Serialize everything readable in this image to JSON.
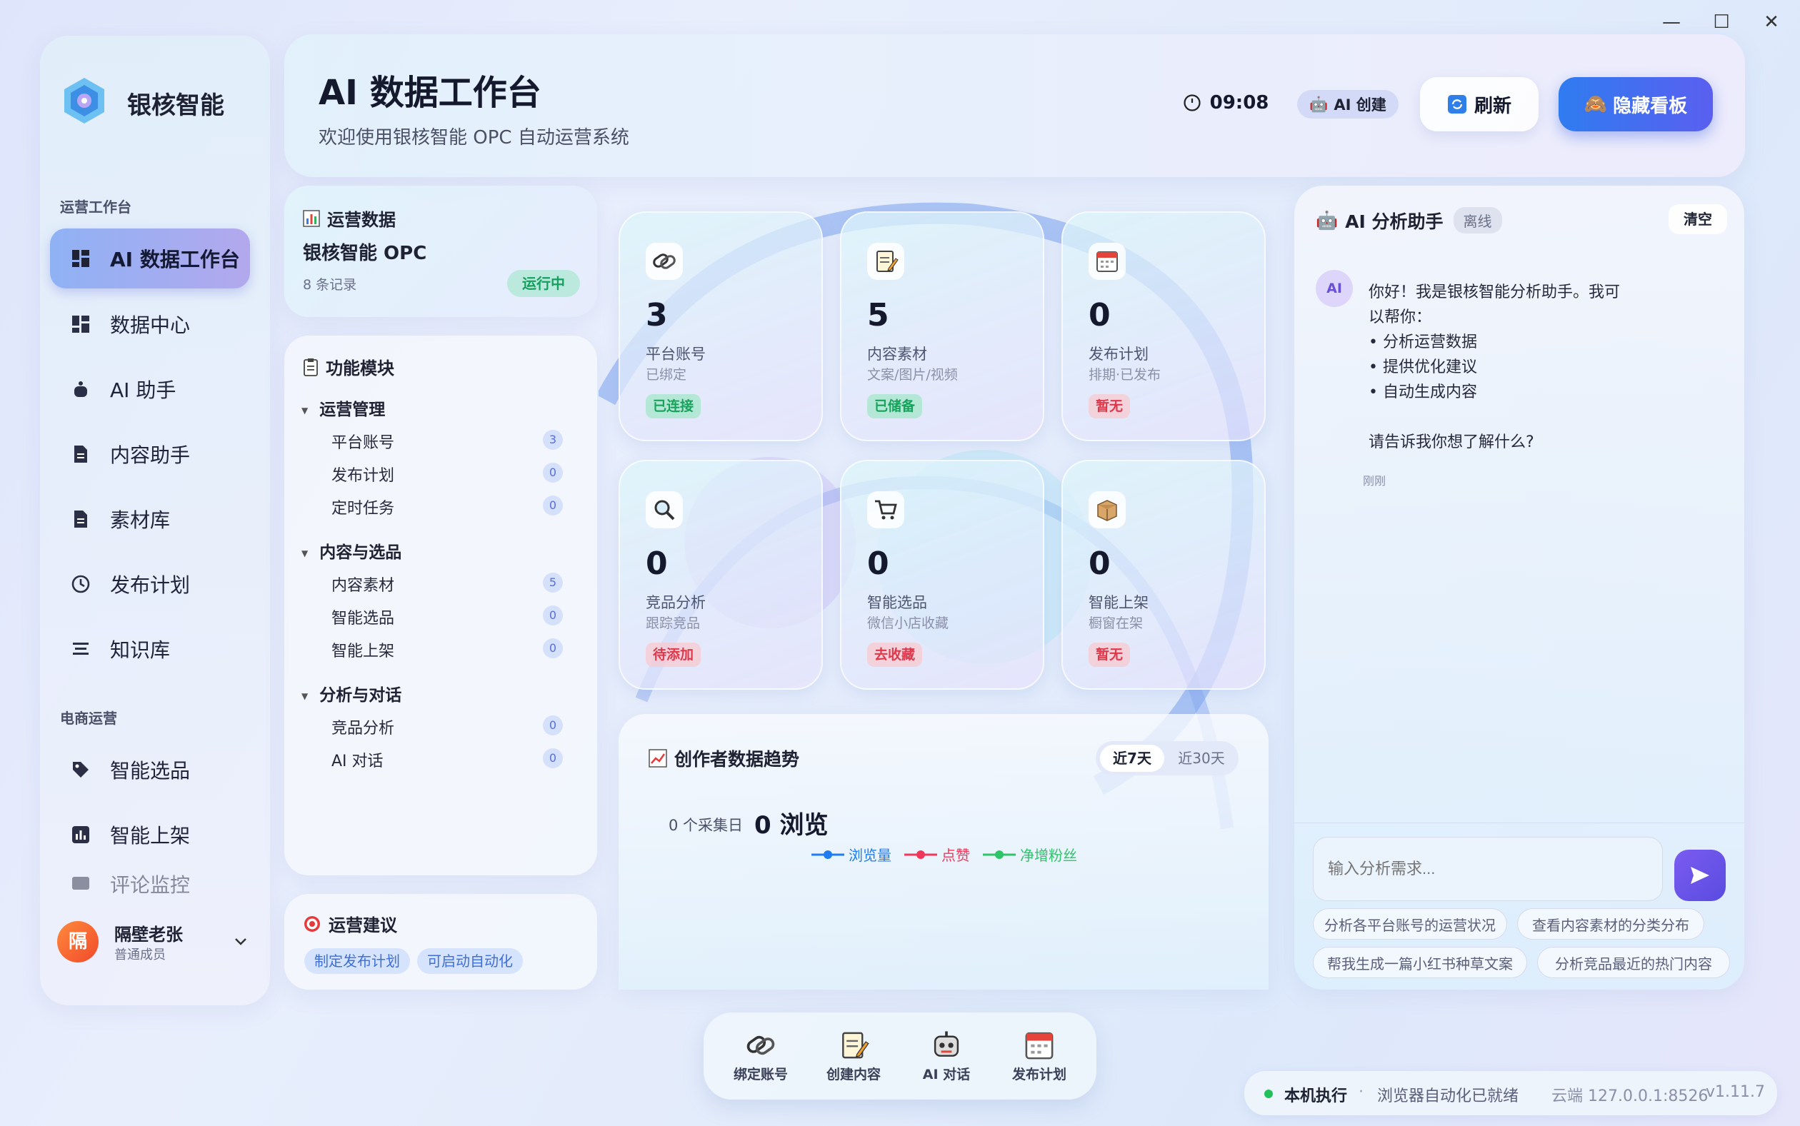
{
  "window": {
    "minimize": "—",
    "maximize": "☐",
    "close": "✕"
  },
  "brand": {
    "name": "银核智能"
  },
  "sidebar": {
    "section1": "运营工作台",
    "items": [
      {
        "label": "AI 数据工作台",
        "icon": "dashboard-icon"
      },
      {
        "label": "数据中心",
        "icon": "grid-icon"
      },
      {
        "label": "AI 助手",
        "icon": "robot-icon"
      },
      {
        "label": "内容助手",
        "icon": "document-icon"
      },
      {
        "label": "素材库",
        "icon": "file-icon"
      },
      {
        "label": "发布计划",
        "icon": "clock-icon"
      },
      {
        "label": "知识库",
        "icon": "book-icon"
      }
    ],
    "section2": "电商运营",
    "items2": [
      {
        "label": "智能选品",
        "icon": "tag-icon"
      },
      {
        "label": "智能上架",
        "icon": "bar-chart-icon"
      },
      {
        "label": "评论监控",
        "icon": "comment-icon"
      }
    ],
    "user": {
      "avatar": "隔",
      "name": "隔壁老张",
      "role": "普通成员"
    }
  },
  "header": {
    "title": "AI 数据工作台",
    "subtitle": "欢迎使用银核智能 OPC 自动运营系统",
    "time": "09:08",
    "ai_badge": "AI 创建",
    "refresh": "刷新",
    "hide_board": "隐藏看板"
  },
  "ops": {
    "title": "运营数据",
    "name": "银核智能 OPC",
    "records": "8 条记录",
    "status": "运行中"
  },
  "modules": {
    "title": "功能模块",
    "groups": [
      {
        "label": "运营管理",
        "items": [
          {
            "label": "平台账号",
            "count": "3"
          },
          {
            "label": "发布计划",
            "count": "0"
          },
          {
            "label": "定时任务",
            "count": "0"
          }
        ]
      },
      {
        "label": "内容与选品",
        "items": [
          {
            "label": "内容素材",
            "count": "5"
          },
          {
            "label": "智能选品",
            "count": "0"
          },
          {
            "label": "智能上架",
            "count": "0"
          }
        ]
      },
      {
        "label": "分析与对话",
        "items": [
          {
            "label": "竞品分析",
            "count": "0"
          },
          {
            "label": "AI 对话",
            "count": "0"
          }
        ]
      }
    ]
  },
  "advice": {
    "title": "运营建议",
    "tags": [
      "制定发布计划",
      "可启动自动化"
    ]
  },
  "tiles": [
    {
      "num": "3",
      "title": "平台账号",
      "sub": "已绑定",
      "tag": "已连接",
      "tone": "green",
      "icon": "link-icon"
    },
    {
      "num": "5",
      "title": "内容素材",
      "sub": "文案/图片/视频",
      "tag": "已储备",
      "tone": "green",
      "icon": "memo-icon"
    },
    {
      "num": "0",
      "title": "发布计划",
      "sub": "排期·已发布",
      "tag": "暂无",
      "tone": "red",
      "icon": "calendar-icon"
    },
    {
      "num": "0",
      "title": "竞品分析",
      "sub": "跟踪竞品",
      "tag": "待添加",
      "tone": "red",
      "icon": "magnifier-icon"
    },
    {
      "num": "0",
      "title": "智能选品",
      "sub": "微信小店收藏",
      "tag": "去收藏",
      "tone": "red",
      "icon": "cart-icon"
    },
    {
      "num": "0",
      "title": "智能上架",
      "sub": "橱窗在架",
      "tag": "暂无",
      "tone": "red",
      "icon": "box-icon"
    }
  ],
  "trend": {
    "title": "创作者数据趋势",
    "tab1": "近7天",
    "tab2": "近30天",
    "collect": "0 个采集日",
    "views": "0 浏览",
    "legend": [
      {
        "name": "浏览量",
        "color": "#1e7cf0"
      },
      {
        "name": "点赞",
        "color": "#f0385a"
      },
      {
        "name": "净增粉丝",
        "color": "#2ec46a"
      }
    ]
  },
  "chat": {
    "title": "AI 分析助手",
    "status": "离线",
    "clear": "清空",
    "bot": "AI",
    "message": [
      "你好！我是银核智能分析助手。我可",
      "以帮你：",
      "• 分析运营数据",
      "• 提供优化建议",
      "• 自动生成内容",
      "",
      "请告诉我你想了解什么?"
    ],
    "time": "刚刚",
    "placeholder": "输入分析需求...",
    "suggestions": [
      "分析各平台账号的运营状况",
      "查看内容素材的分类分布",
      "帮我生成一篇小红书种草文案",
      "分析竞品最近的热门内容"
    ]
  },
  "dock": [
    {
      "label": "绑定账号",
      "icon": "link-icon"
    },
    {
      "label": "创建内容",
      "icon": "memo-icon"
    },
    {
      "label": "AI 对话",
      "icon": "robot-icon"
    },
    {
      "label": "发布计划",
      "icon": "calendar-icon"
    }
  ],
  "statusbar": {
    "mode": "本机执行",
    "browser": "浏览器自动化已就绪",
    "server": "云端 127.0.0.1:8526",
    "version": "v1.11.7"
  }
}
